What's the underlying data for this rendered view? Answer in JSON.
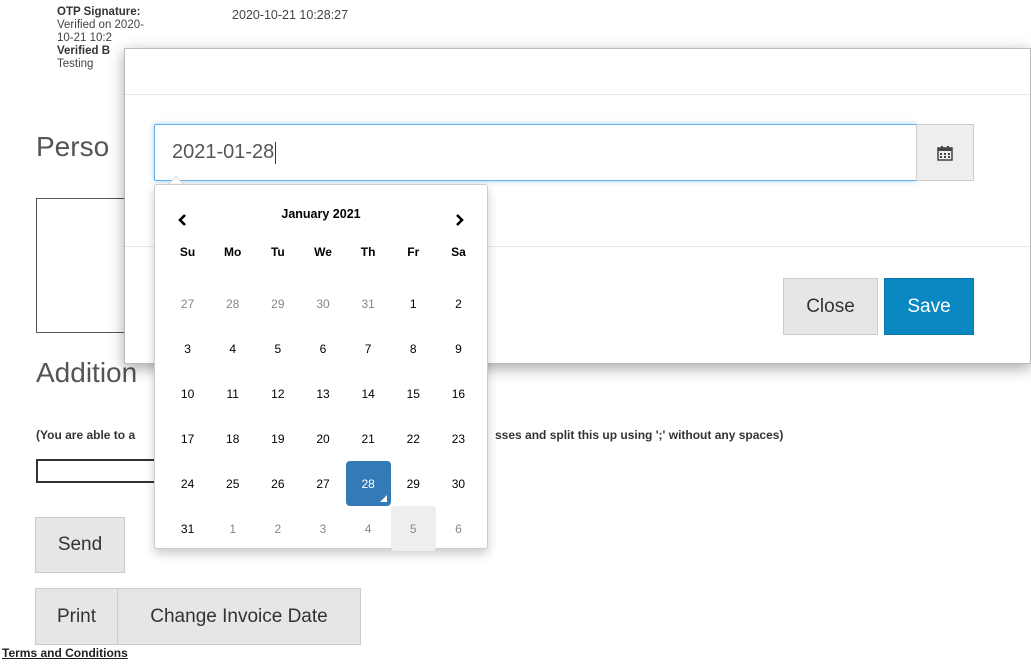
{
  "background": {
    "otp_label": "OTP Signature:",
    "otp_verified_line1": "Verified on 2020-",
    "otp_verified_line2": "10-21 10:2",
    "verified_by_label": "Verified B",
    "verified_by_value": "Testing",
    "otp_timestamp": "2020-10-21 10:28:27",
    "personal_heading": "Perso",
    "additional_heading": "Addition",
    "note_left": "(You are able to a",
    "note_right": "sses and split this up using ';' without any spaces)",
    "send_label": "Send",
    "print_label": "Print",
    "change_invoice_label": "Change Invoice Date",
    "terms_label": "Terms and Conditions"
  },
  "modal": {
    "date_value": "2021-01-28",
    "calendar_icon": "calendar-icon",
    "close_label": "Close",
    "save_label": "Save"
  },
  "datepicker": {
    "prev_symbol": "‹",
    "next_symbol": "›",
    "month_label": "January 2021",
    "weekdays": [
      "Su",
      "Mo",
      "Tu",
      "We",
      "Th",
      "Fr",
      "Sa"
    ],
    "weeks": [
      [
        "27",
        "28",
        "29",
        "30",
        "31",
        "1",
        "2"
      ],
      [
        "3",
        "4",
        "5",
        "6",
        "7",
        "8",
        "9"
      ],
      [
        "10",
        "11",
        "12",
        "13",
        "14",
        "15",
        "16"
      ],
      [
        "17",
        "18",
        "19",
        "20",
        "21",
        "22",
        "23"
      ],
      [
        "24",
        "25",
        "26",
        "27",
        "28",
        "29",
        "30"
      ],
      [
        "31",
        "1",
        "2",
        "3",
        "4",
        "5",
        "6"
      ]
    ],
    "selected_day": "28",
    "today_day": "5"
  },
  "colors": {
    "save_button": "#0a88c2",
    "selected_day": "#337ab7",
    "focus_border": "#66afe9"
  }
}
